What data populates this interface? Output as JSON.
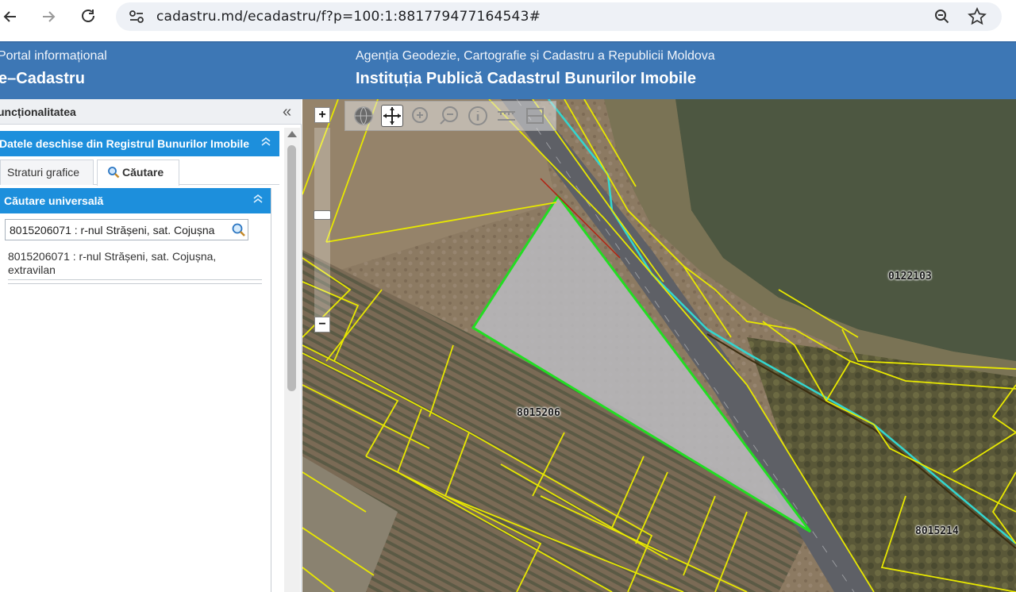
{
  "browser": {
    "url": "cadastru.md/ecadastru/f?p=100:1:881779477164543#",
    "back_icon": "arrow-left-icon",
    "forward_icon": "arrow-right-icon",
    "reload_icon": "reload-icon",
    "zoom_icon": "zoom-out-icon",
    "bookmark_icon": "star-icon"
  },
  "header": {
    "left_small": "Portal informațional",
    "left_big": "e–Cadastru",
    "right_small": "Agenția Geodezie, Cartografie și Cadastru a Republicii Moldova",
    "right_big": "Instituția Publică Cadastrul Bunurilor Imobile"
  },
  "panel": {
    "functionality_title": "uncționalitatea",
    "collapse_glyph": "«",
    "datasets_title": "Datele deschise din Registrul Bunurilor Imobile",
    "tabs": [
      {
        "label": "Straturi grafice",
        "active": false
      },
      {
        "label": "Căutare",
        "active": true
      }
    ],
    "search_title": "Căutare universală",
    "search_value": "8015206071 : r-nul Strășeni, sat. Cojușna",
    "result_line1": "8015206071 : r-nul Strășeni, sat. Cojușna,",
    "result_line2": "extravilan"
  },
  "map": {
    "zoom_in": "+",
    "zoom_out": "−",
    "labels": {
      "parcel_8015206": "8015206",
      "parcel_0122103": "0122103",
      "parcel_8015214": "8015214"
    },
    "tools": [
      "globe-icon",
      "pan-icon",
      "zoom-in-icon",
      "zoom-out-icon",
      "info-icon",
      "measure-line-icon",
      "measure-area-icon"
    ],
    "colors": {
      "parcel_lines": "#e8e800",
      "selected_parcel": "#22dd22",
      "cyan_line": "#33d6d0",
      "header_blue": "#3d77b5",
      "panel_blue": "#1d8fdc"
    }
  }
}
